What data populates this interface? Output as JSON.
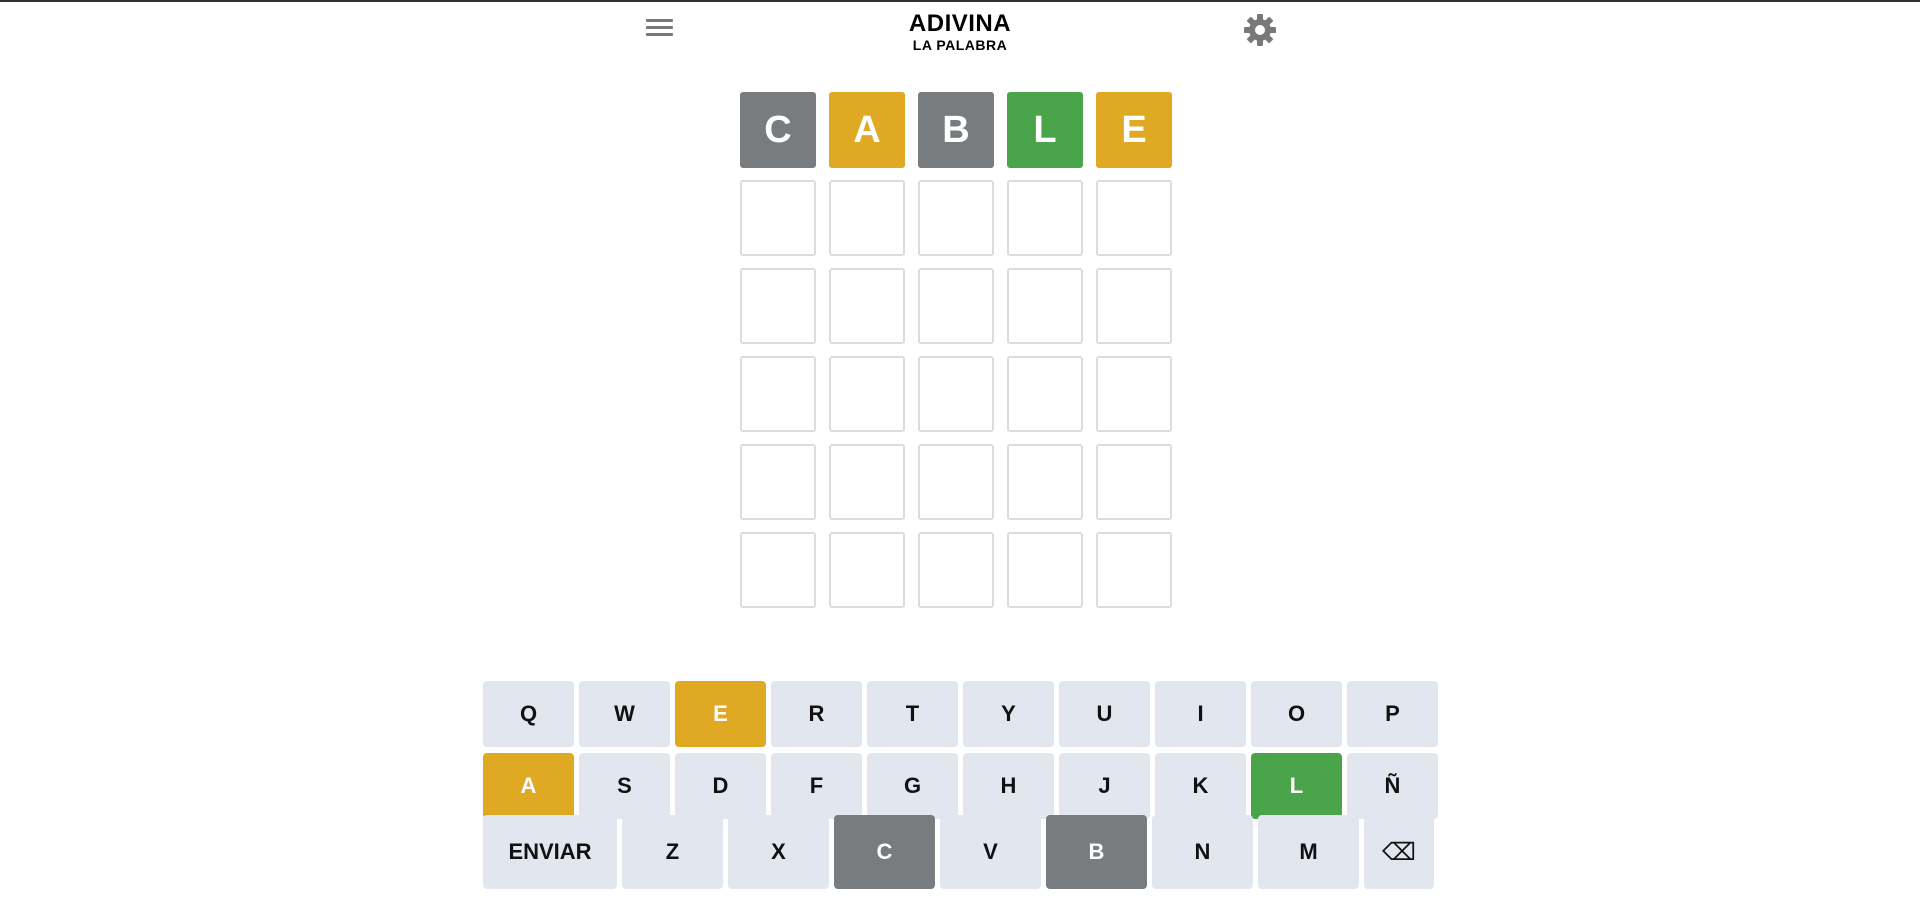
{
  "header": {
    "title": "ADIVINA",
    "subtitle": "LA PALABRA"
  },
  "colors": {
    "absent": "#787c7e",
    "present": "#e0a924",
    "correct": "#4aa44a",
    "key_default": "#e2e6ef",
    "empty_border": "#dcdcdc"
  },
  "board": {
    "rows": [
      [
        {
          "letter": "C",
          "state": "absent"
        },
        {
          "letter": "A",
          "state": "present"
        },
        {
          "letter": "B",
          "state": "absent"
        },
        {
          "letter": "L",
          "state": "correct"
        },
        {
          "letter": "E",
          "state": "present"
        }
      ],
      [
        {
          "letter": "",
          "state": "empty"
        },
        {
          "letter": "",
          "state": "empty"
        },
        {
          "letter": "",
          "state": "empty"
        },
        {
          "letter": "",
          "state": "empty"
        },
        {
          "letter": "",
          "state": "empty"
        }
      ],
      [
        {
          "letter": "",
          "state": "empty"
        },
        {
          "letter": "",
          "state": "empty"
        },
        {
          "letter": "",
          "state": "empty"
        },
        {
          "letter": "",
          "state": "empty"
        },
        {
          "letter": "",
          "state": "empty"
        }
      ],
      [
        {
          "letter": "",
          "state": "empty"
        },
        {
          "letter": "",
          "state": "empty"
        },
        {
          "letter": "",
          "state": "empty"
        },
        {
          "letter": "",
          "state": "empty"
        },
        {
          "letter": "",
          "state": "empty"
        }
      ],
      [
        {
          "letter": "",
          "state": "empty"
        },
        {
          "letter": "",
          "state": "empty"
        },
        {
          "letter": "",
          "state": "empty"
        },
        {
          "letter": "",
          "state": "empty"
        },
        {
          "letter": "",
          "state": "empty"
        }
      ],
      [
        {
          "letter": "",
          "state": "empty"
        },
        {
          "letter": "",
          "state": "empty"
        },
        {
          "letter": "",
          "state": "empty"
        },
        {
          "letter": "",
          "state": "empty"
        },
        {
          "letter": "",
          "state": "empty"
        }
      ]
    ]
  },
  "keyboard": {
    "rows": [
      [
        {
          "label": "Q",
          "state": "default"
        },
        {
          "label": "W",
          "state": "default"
        },
        {
          "label": "E",
          "state": "present"
        },
        {
          "label": "R",
          "state": "default"
        },
        {
          "label": "T",
          "state": "default"
        },
        {
          "label": "Y",
          "state": "default"
        },
        {
          "label": "U",
          "state": "default"
        },
        {
          "label": "I",
          "state": "default"
        },
        {
          "label": "O",
          "state": "default"
        },
        {
          "label": "P",
          "state": "default"
        }
      ],
      [
        {
          "label": "A",
          "state": "present"
        },
        {
          "label": "S",
          "state": "default"
        },
        {
          "label": "D",
          "state": "default"
        },
        {
          "label": "F",
          "state": "default"
        },
        {
          "label": "G",
          "state": "default"
        },
        {
          "label": "H",
          "state": "default"
        },
        {
          "label": "J",
          "state": "default"
        },
        {
          "label": "K",
          "state": "default"
        },
        {
          "label": "L",
          "state": "correct"
        },
        {
          "label": "Ñ",
          "state": "default"
        }
      ],
      [
        {
          "label": "ENVIAR",
          "state": "default",
          "kind": "enter"
        },
        {
          "label": "Z",
          "state": "default"
        },
        {
          "label": "X",
          "state": "default"
        },
        {
          "label": "C",
          "state": "absent"
        },
        {
          "label": "V",
          "state": "default"
        },
        {
          "label": "B",
          "state": "absent"
        },
        {
          "label": "N",
          "state": "default"
        },
        {
          "label": "M",
          "state": "default"
        },
        {
          "label": "⌫",
          "state": "default",
          "kind": "backspace"
        }
      ]
    ]
  }
}
